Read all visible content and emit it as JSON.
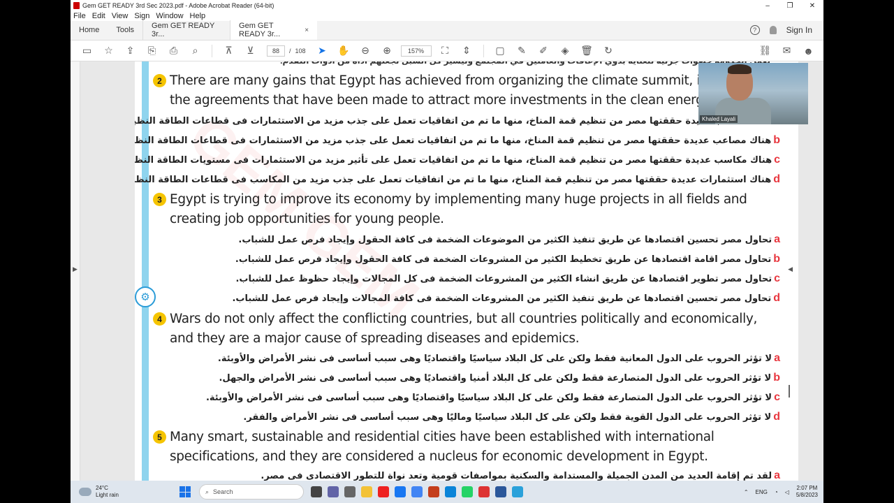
{
  "window": {
    "title": "Gem GET READY 3rd Sec 2023.pdf - Adobe Acrobat Reader (64-bit)",
    "controls": {
      "minimize": "–",
      "maximize": "❐",
      "close": "✕"
    }
  },
  "menu": [
    "File",
    "Edit",
    "View",
    "Sign",
    "Window",
    "Help"
  ],
  "tabs": {
    "home": "Home",
    "tools": "Tools",
    "doc1": "Gem GET READY 3r...",
    "doc2": "Gem GET READY 3r...",
    "close": "×"
  },
  "account": {
    "help": "?",
    "signin": "Sign In"
  },
  "toolbar": {
    "page_current": "88",
    "page_sep": "/",
    "page_total": "108",
    "zoom": "157%"
  },
  "document": {
    "top_partial": "تعمل الحكومة خطوات جرئية للعناية بذوي الإعاقات والعاملين في المجتمع وتيسير كل السبل لجعلهم أداة من أدوات التقدم.",
    "questions": [
      {
        "num": "2",
        "line1": "There are many gains that Egypt has achieved from organizing the climate summit, includ",
        "line2": "the agreements that have been made to attract more investments in the clean energy sect",
        "options": [
          {
            "letter": "a",
            "text": "هناك مكاسب عديدة حققتها مصر من تنظيم قمة المناخ، منها ما تم من اتفاقيات تعمل على جذب مزيد من الاستثمارات فى قطاعات الطاقة النظيفة."
          },
          {
            "letter": "b",
            "text": "هناك مصاعب عديدة حققتها مصر من تنظيم قمة المناخ، منها ما تم من اتفاقيات تعمل على جذب مزيد من الاستثمارات فى قطاعات الطاقة النظيفة."
          },
          {
            "letter": "c",
            "text": "هناك مكاسب عديدة حققتها مصر من تنظيم قمة المناخ، منها ما تم من اتفاقيات تعمل على تأثير مزيد من الاستثمارات فى مستويات الطاقة النظيفة."
          },
          {
            "letter": "d",
            "text": "هناك استثمارات عديدة حققتها مصر من تنظيم قمة المناخ، منها ما تم من اتفاقيات تعمل على جذب مزيد من المكاسب فى قطاعات الطاقة النظيفة."
          }
        ]
      },
      {
        "num": "3",
        "line1": "Egypt is trying to improve its economy by implementing many huge projects in all fields and",
        "line2": "creating job opportunities for young people.",
        "options": [
          {
            "letter": "a",
            "text": "تحاول مصر تحسين اقتصادها عن طريق تنفيذ الكثير من الموضوعات الضخمة فى كافة الحقول وإيجاد فرص عمل للشباب."
          },
          {
            "letter": "b",
            "text": "تحاول مصر اقامة اقتصادها عن طريق تخطيط الكثير من المشروعات الضخمة فى كافة الحقول وإيجاد فرص عمل للشباب."
          },
          {
            "letter": "c",
            "text": "تحاول مصر تطوير اقتصادها عن طريق انشاء الكثير من المشروعات الضخمة فى كل المجالات وإيجاد حظوظ عمل للشباب."
          },
          {
            "letter": "d",
            "text": "تحاول مصر تحسين اقتصادها عن طريق تنفيذ الكثير من المشروعات الضخمة فى كافة المجالات وإيجاد فرص عمل للشباب."
          }
        ]
      },
      {
        "num": "4",
        "line1": "Wars do not only affect the conflicting countries, but all countries politically and economically,",
        "line2": "and they are a major cause of spreading diseases and epidemics.",
        "options": [
          {
            "letter": "a",
            "text": "لا تؤثر الحروب على الدول المعانية فقط ولكن على كل البلاد سياسيًا واقتصاديًا وهى سبب أساسى فى نشر الأمراض والأوبئة."
          },
          {
            "letter": "b",
            "text": "لا تؤثر الحروب على الدول المتصارعة فقط ولكن على كل البلاد أمنيا واقتصاديًا وهى سبب أساسى فى نشر الأمراض والجهل."
          },
          {
            "letter": "c",
            "text": "لا تؤثر الحروب على الدول المتصارعة فقط ولكن على كل البلاد سياسيًا واقتصاديًا وهى سبب أساسى فى نشر الأمراض والأوبئة."
          },
          {
            "letter": "d",
            "text": "لا تؤثر الحروب على الدول القوية فقط ولكن على كل البلاد سياسيًا وماليًا وهى سبب أساسى فى نشر الأمراض والفقر."
          }
        ]
      },
      {
        "num": "5",
        "line1": "Many smart, sustainable and residential cities have been established with international",
        "line2": "specifications, and they are considered a nucleus for economic development in Egypt.",
        "options": [
          {
            "letter": "a",
            "text": "لقد تم إقامة العديد من المدن الجميلة والمستدامة والسكنية بمواصفات قومية وتعد نواة للتطور الاقتصادى فى مصر."
          }
        ]
      }
    ]
  },
  "webcam": {
    "name": "Khaled Layali"
  },
  "taskbar": {
    "temp": "24°C",
    "weather": "Light rain",
    "search": "Search",
    "lang": "ENG",
    "time": "2:07 PM",
    "date": "5/8/2023"
  }
}
